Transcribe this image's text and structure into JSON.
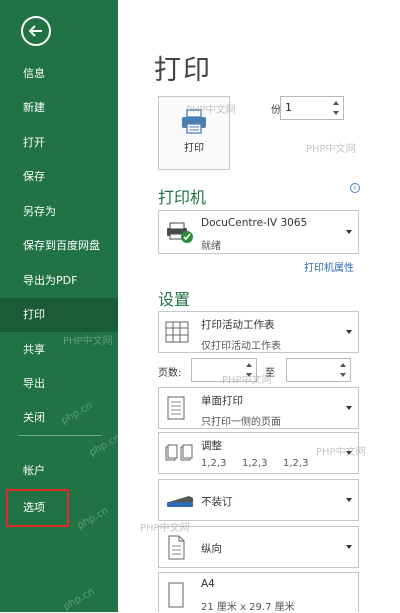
{
  "sidebar": {
    "items": [
      {
        "label": "信息"
      },
      {
        "label": "新建"
      },
      {
        "label": "打开"
      },
      {
        "label": "保存"
      },
      {
        "label": "另存为"
      },
      {
        "label": "保存到百度网盘"
      },
      {
        "label": "导出为PDF"
      },
      {
        "label": "打印"
      },
      {
        "label": "共享"
      },
      {
        "label": "导出"
      },
      {
        "label": "关闭"
      },
      {
        "label": "帐户"
      },
      {
        "label": "选项"
      }
    ],
    "active_item": "打印",
    "highlighted_item": "选项"
  },
  "page": {
    "title": "打印",
    "print_button_label": "打印",
    "copies_label": "份数:",
    "copies_value": "1"
  },
  "printer": {
    "section_title": "打印机",
    "name": "DocuCentre-IV 3065",
    "status": "就绪",
    "properties_link": "打印机属性"
  },
  "settings": {
    "section_title": "设置",
    "scope": {
      "line1": "打印活动工作表",
      "line2": "仅打印活动工作表"
    },
    "pages_label": "页数:",
    "to_label": "至",
    "sides": {
      "line1": "单面打印",
      "line2": "只打印一侧的页面"
    },
    "collate": {
      "line1": "调整",
      "line2": [
        "1,2,3",
        "1,2,3",
        "1,2,3"
      ]
    },
    "staple": {
      "line1": "不装订"
    },
    "orientation": {
      "line1": "纵向"
    },
    "paper": {
      "line1": "A4",
      "line2": "21 厘米 x 29.7 厘米"
    }
  },
  "watermark": {
    "text_cn": "PHP中文网",
    "text_en": "php.cn"
  },
  "colors": {
    "sidebar_bg": "#217346",
    "sidebar_active": "#1a5c38",
    "accent_green": "#217346",
    "link_blue": "#2b6cb0",
    "highlight_red": "#e02b2b"
  }
}
